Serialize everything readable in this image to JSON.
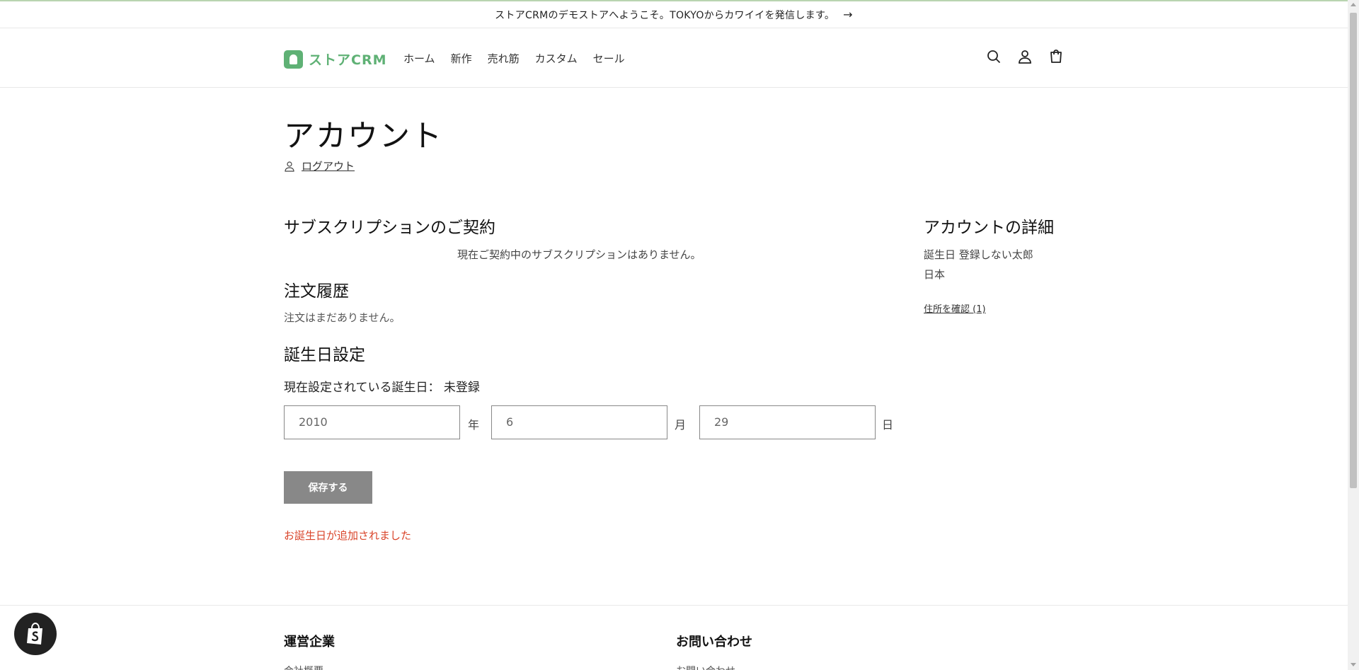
{
  "announcement": {
    "text": "ストアCRMのデモストアへようこそ。TOKYOからカワイイを発信します。",
    "arrow": "→"
  },
  "header": {
    "logo_text": "ストアCRM",
    "nav": [
      "ホーム",
      "新作",
      "売れ筋",
      "カスタム",
      "セール"
    ],
    "icons": [
      "search-icon",
      "account-icon",
      "cart-icon"
    ]
  },
  "account": {
    "title": "アカウント",
    "logout_label": "ログアウト"
  },
  "subscriptions": {
    "heading": "サブスクリプションのご契約",
    "empty_text": "現在ご契約中のサブスクリプションはありません。"
  },
  "orders": {
    "heading": "注文履歴",
    "empty_text": "注文はまだありません。"
  },
  "birthday": {
    "heading": "誕生日設定",
    "current_label": "現在設定されている誕生日： 未登録",
    "year_value": "2010",
    "year_unit": "年",
    "month_value": "6",
    "month_unit": "月",
    "day_value": "29",
    "day_unit": "日",
    "save_label": "保存する",
    "success_message": "お誕生日が追加されました"
  },
  "details": {
    "heading": "アカウントの詳細",
    "name_line": "誕生日 登録しない太郎",
    "country": "日本",
    "address_link": "住所を確認 (1)"
  },
  "footer": {
    "company_heading": "運営企業",
    "company_sub": "会社概要",
    "contact_heading": "お問い合わせ",
    "contact_sub": "お問い合わせ"
  },
  "colors": {
    "brand": "#5fb175",
    "error": "#d9442a",
    "button": "#888888"
  }
}
